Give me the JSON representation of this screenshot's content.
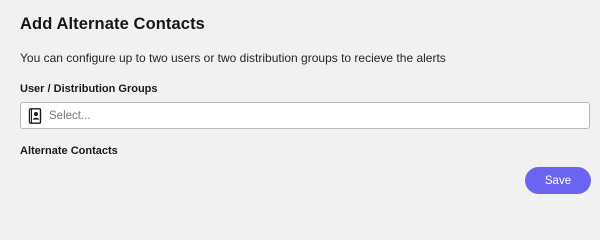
{
  "dialog": {
    "title": "Add Alternate Contacts",
    "description": "You can configure up to two users or two distribution groups to recieve the alerts"
  },
  "groups_field": {
    "label": "User / Distribution Groups",
    "placeholder": "Select...",
    "icon": "contact-book-icon"
  },
  "alternate_contacts": {
    "label": "Alternate Contacts"
  },
  "actions": {
    "save_label": "Save"
  },
  "colors": {
    "background": "#f2f1f1",
    "accent": "#6b64f1",
    "input_border": "#b9b9b9"
  }
}
